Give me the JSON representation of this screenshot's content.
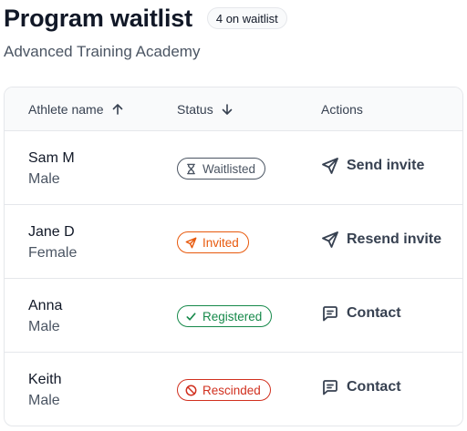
{
  "header": {
    "title": "Program waitlist",
    "count_badge": "4 on waitlist",
    "subtitle": "Advanced Training Academy"
  },
  "table": {
    "columns": {
      "name": "Athlete name",
      "status": "Status",
      "actions": "Actions"
    },
    "rows": [
      {
        "name": "Sam M",
        "gender": "Male",
        "status": "Waitlisted",
        "status_icon": "hourglass-icon",
        "status_color": "#4b5563",
        "action": "Send invite",
        "action_icon": "send-icon"
      },
      {
        "name": "Jane D",
        "gender": "Female",
        "status": "Invited",
        "status_icon": "send-icon",
        "status_color": "#e8590c",
        "action": "Resend invite",
        "action_icon": "send-icon"
      },
      {
        "name": "Anna",
        "gender": "Male",
        "status": "Registered",
        "status_icon": "check-icon",
        "status_color": "#16894a",
        "action": "Contact",
        "action_icon": "message-icon"
      },
      {
        "name": "Keith",
        "gender": "Male",
        "status": "Rescinded",
        "status_icon": "ban-icon",
        "status_color": "#d1301f",
        "action": "Contact",
        "action_icon": "message-icon"
      }
    ]
  }
}
